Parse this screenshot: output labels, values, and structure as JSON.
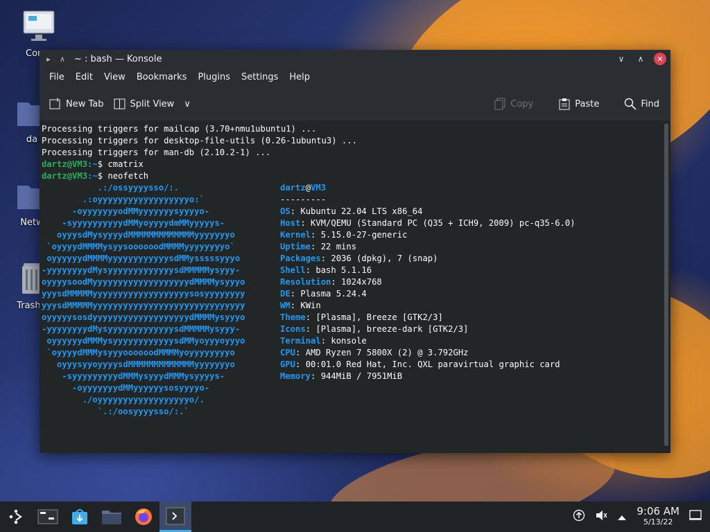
{
  "desktop": {
    "icons": [
      {
        "label": "Comp",
        "name": "computer"
      },
      {
        "label": "da",
        "name": "home-folder"
      },
      {
        "label": "Netw",
        "name": "network"
      },
      {
        "label": "Trash (",
        "name": "trash"
      }
    ]
  },
  "window": {
    "title": "~ : bash — Konsole",
    "menu": [
      "File",
      "Edit",
      "View",
      "Bookmarks",
      "Plugins",
      "Settings",
      "Help"
    ],
    "toolbar": {
      "new_tab": "New Tab",
      "split_view": "Split View",
      "copy": "Copy",
      "paste": "Paste",
      "find": "Find"
    }
  },
  "terminal": {
    "output_lines": [
      "Processing triggers for mailcap (3.70+nmu1ubuntu1) ...",
      "Processing triggers for desktop-file-utils (0.26-1ubuntu3) ...",
      "Processing triggers for man-db (2.10.2-1) ..."
    ],
    "prompt_user": "dartz@VM3",
    "prompt_path": ":~",
    "prompt_symbol": "$ ",
    "commands": [
      "cmatrix",
      "neofetch"
    ],
    "logo": [
      "           .:/ossyyyysso/:.",
      "        .:oyyyyyyyyyyyyyyyyyyo:`",
      "      -oyyyyyyyodMMyyyyyyysyyyyo-",
      "    -syyyyyyyyyydMMyoyyyydmMMyyyyys-",
      "   oyyysdMysyyyydMMMMMMMMMMMMMyyyyyyyo",
      " `oyyyydMMMMysyysoooooodMMMMyyyyyyyyo`",
      " oyyyyyydMMMMyyyyyyyyyyyysdMMysssssyyyo",
      "-yyyyyyyydMysyyyyyyyyyyyyysdMMMMMysyyy-",
      "oyyyysoodMyyyyyyyyyyyyyyyyyyydMMMMysyyyo",
      "yyysdMMMMMyyyyyyyyyyyyyyyyyyysosyyyyyyyy",
      "yyysdMMMMMyyyyyyyyyyyyyyyyyyyyyyyyyyyyyy",
      "oyyyyysosdyyyyyyyyyyyyyyyyyyydMMMMysyyyo",
      "-yyyyyyyydMysyyyyyyyyyyyyysdMMMMMysyyy-",
      " oyyyyyydMMMysyyyyyyyyyyyysdMMyoyyyoyyyo",
      " `oyyyydMMMysyyyoooooodMMMMyoyyyyyyyyo",
      "   oyyysyyoyyyysdMMMMMMMMMMMMMyyyyyyyo",
      "    -syyyyyyyyydMMMysyyydMMMysyyyys-",
      "      -oyyyyyyydMMyyyyyysosyyyyo-",
      "        ./oyyyyyyyyyyyyyyyyyyo/.",
      "           `.:/oosyyyysso/:.`"
    ],
    "info_user": "dartz",
    "info_at": "@",
    "info_host": "VM3",
    "info_sep": "---------",
    "info": [
      {
        "key": "OS",
        "value": ": Kubuntu 22.04 LTS x86_64"
      },
      {
        "key": "Host",
        "value": ": KVM/QEMU (Standard PC (Q35 + ICH9, 2009) pc-q35-6.0)"
      },
      {
        "key": "Kernel",
        "value": ": 5.15.0-27-generic"
      },
      {
        "key": "Uptime",
        "value": ": 22 mins"
      },
      {
        "key": "Packages",
        "value": ": 2036 (dpkg), 7 (snap)"
      },
      {
        "key": "Shell",
        "value": ": bash 5.1.16"
      },
      {
        "key": "Resolution",
        "value": ": 1024x768"
      },
      {
        "key": "DE",
        "value": ": Plasma 5.24.4"
      },
      {
        "key": "WM",
        "value": ": KWin"
      },
      {
        "key": "Theme",
        "value": ": [Plasma], Breeze [GTK2/3]"
      },
      {
        "key": "Icons",
        "value": ": [Plasma], breeze-dark [GTK2/3]"
      },
      {
        "key": "Terminal",
        "value": ": konsole"
      },
      {
        "key": "CPU",
        "value": ": AMD Ryzen 7 5800X (2) @ 3.792GHz"
      },
      {
        "key": "GPU",
        "value": ": 00:01.0 Red Hat, Inc. QXL paravirtual graphic card"
      },
      {
        "key": "Memory",
        "value": ": 944MiB / 7951MiB"
      }
    ],
    "palette_top": [
      "#232627",
      "#ed1515",
      "#11d116",
      "#f67400",
      "#1d99f3",
      "#9b59b6",
      "#1abc9c",
      "#fcfcfc"
    ],
    "palette_bottom": [
      "#7f8c8d",
      "#c0392b",
      "#1cdc9a",
      "#fdbc4b",
      "#3daee9",
      "#8e44ad",
      "#16a085",
      "#ffffff"
    ]
  },
  "taskbar": {
    "apps": [
      "application-launcher",
      "pager",
      "discover",
      "dolphin",
      "firefox",
      "konsole"
    ],
    "time": "9:06 AM",
    "date": "5/13/22"
  }
}
